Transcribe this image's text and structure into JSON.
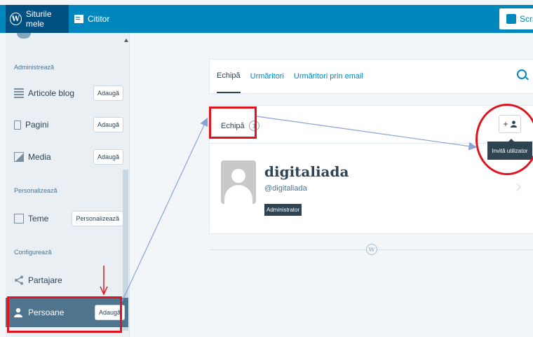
{
  "topbar": {
    "my_sites": "Siturile mele",
    "reader": "Cititor",
    "write": "Scrie"
  },
  "sidebar": {
    "manage_header": "Administrează",
    "personalize_header": "Personalizează",
    "configure_header": "Configurează",
    "items": [
      {
        "label": "Articole blog",
        "button": "Adaugă",
        "icon": "posts-icon"
      },
      {
        "label": "Pagini",
        "button": "Adaugă",
        "icon": "pages-icon"
      },
      {
        "label": "Media",
        "button": "Adaugă",
        "icon": "media-icon"
      },
      {
        "label": "Teme",
        "button": "Personalizează",
        "icon": "themes-icon"
      },
      {
        "label": "Partajare",
        "icon": "share-icon"
      },
      {
        "label": "Persoane",
        "button": "Adaugă",
        "icon": "person-icon"
      }
    ]
  },
  "tabs": [
    "Echipă",
    "Urmăritori",
    "Urmăritori prin email"
  ],
  "team": {
    "title": "Echipă",
    "count": "1",
    "invite_tooltip": "Invită utilizator",
    "invite_button": "+",
    "user": {
      "name": "digitaliada",
      "handle": "@digitaliada",
      "role": "Administrator"
    }
  },
  "colors": {
    "topbar": "#0087be",
    "annotation": "#e0141e",
    "arrow": "#8aa2d6",
    "sidebar_active": "#4f748e"
  }
}
